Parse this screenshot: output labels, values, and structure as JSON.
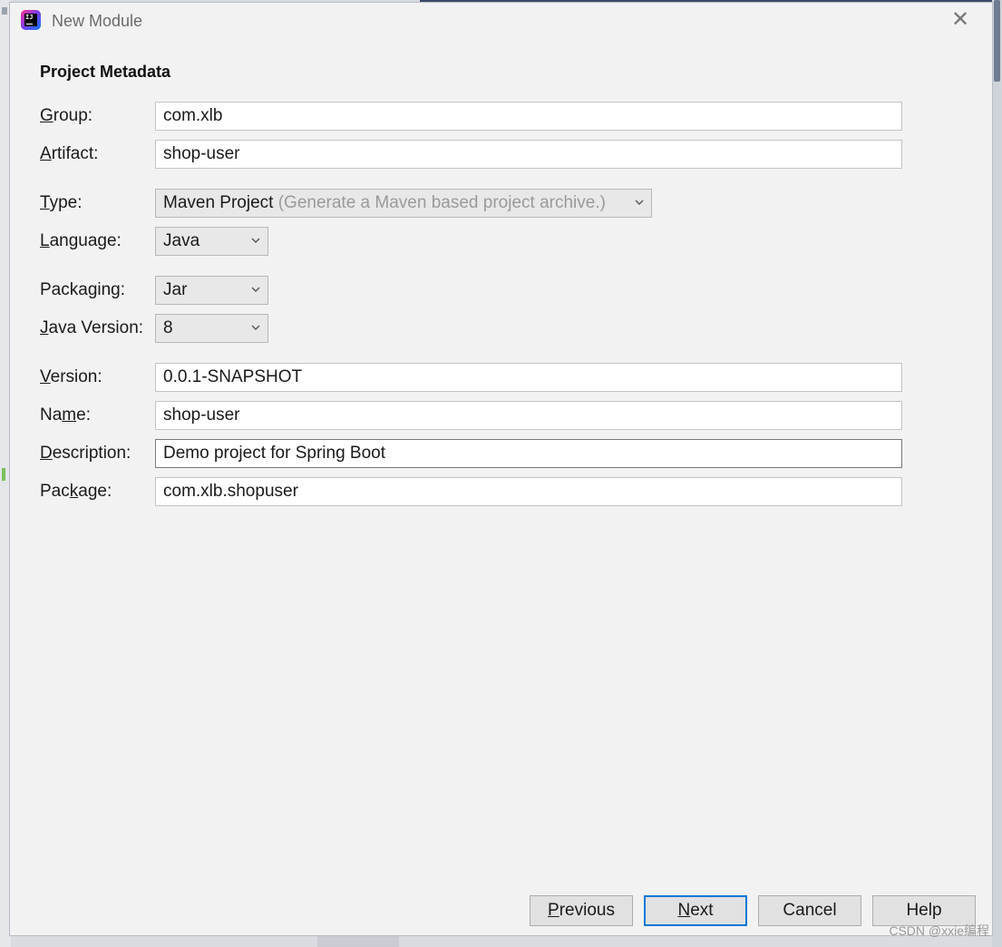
{
  "window": {
    "title": "New Module",
    "close_label": "✕"
  },
  "section_title": "Project Metadata",
  "form": {
    "group": {
      "label_u": "G",
      "label_rest": "roup:",
      "value": "com.xlb"
    },
    "artifact": {
      "label_u": "A",
      "label_rest": "rtifact:",
      "value": "shop-user"
    },
    "type": {
      "label_u": "T",
      "label_rest": "ype:",
      "value": "Maven Project",
      "hint": "(Generate a Maven based project archive.)"
    },
    "language": {
      "label_u": "L",
      "label_rest": "anguage:",
      "value": "Java"
    },
    "packaging": {
      "label_pre": "Packa",
      "label_u": "g",
      "label_rest": "ing:",
      "value": "Jar"
    },
    "java_version": {
      "label_u": "J",
      "label_rest": "ava Version:",
      "value": "8"
    },
    "version": {
      "label_u": "V",
      "label_rest": "ersion:",
      "value": "0.0.1-SNAPSHOT"
    },
    "name": {
      "label_pre": "Na",
      "label_u": "m",
      "label_rest": "e:",
      "value": "shop-user"
    },
    "description": {
      "label_u": "D",
      "label_rest": "escription:",
      "value": "Demo project for Spring Boot"
    },
    "package": {
      "label_pre": "Pac",
      "label_u": "k",
      "label_rest": "age:",
      "value": "com.xlb.shopuser"
    }
  },
  "buttons": {
    "previous": {
      "u": "P",
      "rest": "revious"
    },
    "next": {
      "u": "N",
      "rest": "ext"
    },
    "cancel": "Cancel",
    "help": "Help"
  },
  "watermark": "CSDN @xxie编程",
  "icons": {
    "app": "intellij-idea-icon",
    "close": "close-icon",
    "dropdown": "chevron-down-icon"
  },
  "colors": {
    "dialog_bg": "#f2f2f2",
    "default_button_border": "#0078d7",
    "hint_text": "#9a9a9a"
  }
}
